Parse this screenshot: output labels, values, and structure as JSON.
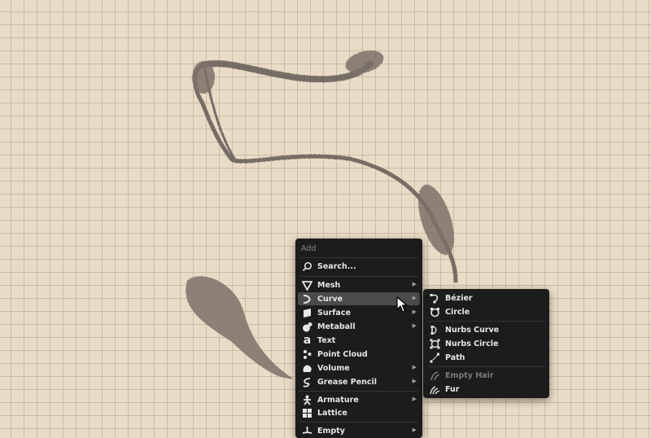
{
  "add_menu": {
    "title": "Add",
    "search_label": "Search...",
    "items": [
      {
        "label": "Mesh",
        "icon": "mesh-icon",
        "submenu": true
      },
      {
        "label": "Curve",
        "icon": "curve-icon",
        "submenu": true
      },
      {
        "label": "Surface",
        "icon": "surface-icon",
        "submenu": true
      },
      {
        "label": "Metaball",
        "icon": "metaball-icon",
        "submenu": true
      },
      {
        "label": "Text",
        "icon": "text-icon",
        "submenu": false
      },
      {
        "label": "Point Cloud",
        "icon": "point-cloud-icon",
        "submenu": false
      },
      {
        "label": "Volume",
        "icon": "volume-icon",
        "submenu": true
      },
      {
        "label": "Grease Pencil",
        "icon": "grease-pencil-icon",
        "submenu": true
      },
      {
        "label": "Armature",
        "icon": "armature-icon",
        "submenu": true
      },
      {
        "label": "Lattice",
        "icon": "lattice-icon",
        "submenu": false
      },
      {
        "label": "Empty",
        "icon": "empty-icon",
        "submenu": true
      }
    ]
  },
  "curve_submenu": {
    "items": [
      {
        "label": "Bézier",
        "icon": "bezier-icon"
      },
      {
        "label": "Circle",
        "icon": "circle-curve-icon"
      },
      {
        "label": "Nurbs Curve",
        "icon": "nurbs-curve-icon"
      },
      {
        "label": "Nurbs Circle",
        "icon": "nurbs-circle-icon"
      },
      {
        "label": "Path",
        "icon": "path-icon"
      },
      {
        "label": "Empty Hair",
        "icon": "empty-hair-icon",
        "disabled": true
      },
      {
        "label": "Fur",
        "icon": "fur-icon"
      }
    ]
  }
}
